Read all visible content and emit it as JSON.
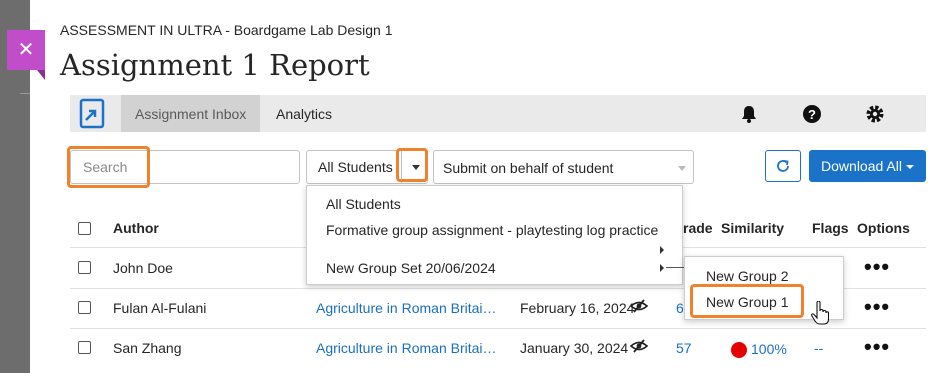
{
  "header": {
    "course_title": "ASSESSMENT IN ULTRA - Boardgame Lab Design 1",
    "page_title": "Assignment 1 Report",
    "close_icon": "close-icon"
  },
  "nav": {
    "tabs": [
      {
        "label": "Assignment Inbox",
        "active": true
      },
      {
        "label": "Analytics",
        "active": false
      }
    ],
    "icons": [
      "bell-icon",
      "help-icon",
      "gear-icon"
    ]
  },
  "toolbar": {
    "search_placeholder": "Search",
    "filter_value": "All Students",
    "submit_on_behalf": "Submit on behalf of student",
    "download_label": "Download All",
    "accent_color": "#1a73c9",
    "highlight_color": "#f0822e"
  },
  "filter_menu": {
    "items": [
      "All Students",
      "Formative group assignment - playtesting log practice",
      "",
      "New Group Set 20/06/2024"
    ],
    "submenu": [
      "New Group 2",
      "New Group 1"
    ]
  },
  "table": {
    "headers": {
      "author": "Author",
      "grade": "rade",
      "similarity": "Similarity",
      "flags": "Flags",
      "options": "Options"
    },
    "rows": [
      {
        "author": "John Doe",
        "submission": "",
        "date": "",
        "grade": "",
        "similarity": "",
        "flags": ""
      },
      {
        "author": "Fulan Al-Fulani",
        "submission": "Agriculture in Roman Britai…",
        "date": "February 16, 2024",
        "grade": "6",
        "similarity": "",
        "flags": ""
      },
      {
        "author": "San Zhang",
        "submission": "Agriculture in Roman Britai…",
        "date": "January 30, 2024",
        "grade": "57",
        "similarity": "100%",
        "flags": "--"
      }
    ],
    "options_label": "•••"
  }
}
